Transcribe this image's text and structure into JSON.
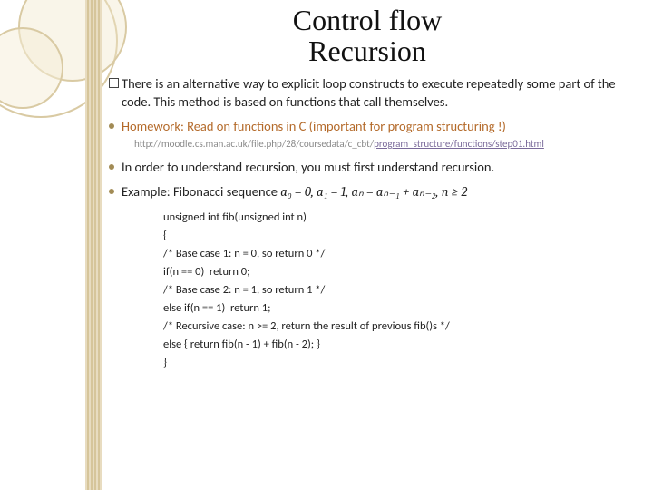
{
  "title_line1": "Control flow",
  "title_line2": "Recursion",
  "bullets": {
    "intro": "There is an alternative way to explicit loop constructs to execute repeatedly some part of the  code. This method is based on functions that call themselves.",
    "homework_label": "Homework",
    "homework_text": ": Read on functions in C (important for program structuring !)",
    "link_prefix": "http://moodle.cs.man.ac.uk/file.php/28/coursedata/c_cbt/",
    "link_underlined": "program_structure/functions/step01.html",
    "recursion_joke": "In order to understand recursion, you must first understand recursion.",
    "example_label": "Example",
    "example_text": ": Fibonacci sequence ",
    "formula": "a₀ = 0, a₁ = 1, aₙ = aₙ₋₁ + aₙ₋₂, n ≥ 2"
  },
  "code": [
    "unsigned int fib(unsigned int n)",
    "{",
    "/* Base case 1: n = 0, so return 0 */",
    "if(n == 0)  return 0;",
    "/* Base case 2: n = 1, so return 1 */",
    "else if(n == 1)  return 1;",
    "/* Recursive case: n >= 2, return the result of previous fib()s */",
    "else { return fib(n - 1) + fib(n - 2); }",
    "}"
  ]
}
